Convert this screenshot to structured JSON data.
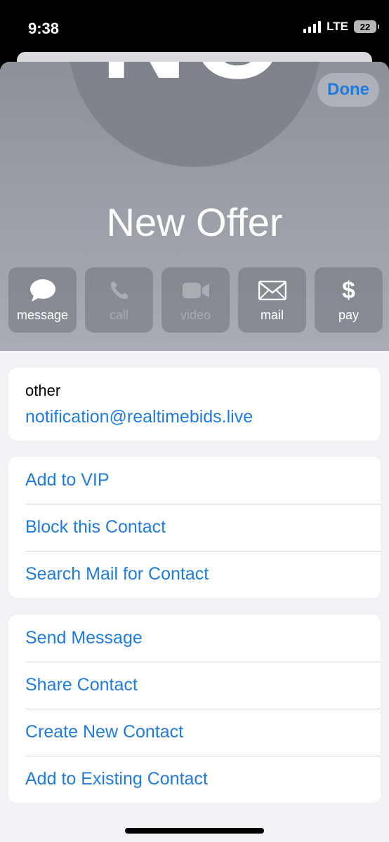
{
  "status_bar": {
    "time": "9:38",
    "network": "LTE",
    "battery": "22"
  },
  "header": {
    "avatar_initials": "NO",
    "done_label": "Done",
    "contact_name": "New Offer"
  },
  "actions": [
    {
      "label": "message",
      "icon": "message-bubble-icon",
      "enabled": true
    },
    {
      "label": "call",
      "icon": "phone-icon",
      "enabled": false
    },
    {
      "label": "video",
      "icon": "video-camera-icon",
      "enabled": false
    },
    {
      "label": "mail",
      "icon": "envelope-icon",
      "enabled": true
    },
    {
      "label": "pay",
      "icon": "dollar-icon",
      "enabled": true
    }
  ],
  "email": {
    "type_label": "other",
    "address": "notification@realtimebids.live"
  },
  "group_a": [
    "Add to VIP",
    "Block this Contact",
    "Search Mail for Contact"
  ],
  "group_b": [
    "Send Message",
    "Share Contact",
    "Create New Contact",
    "Add to Existing Contact"
  ],
  "colors": {
    "accent": "#1f7bdf",
    "header_top": "#8d9199",
    "sheet_bg": "#f1f1f6"
  }
}
